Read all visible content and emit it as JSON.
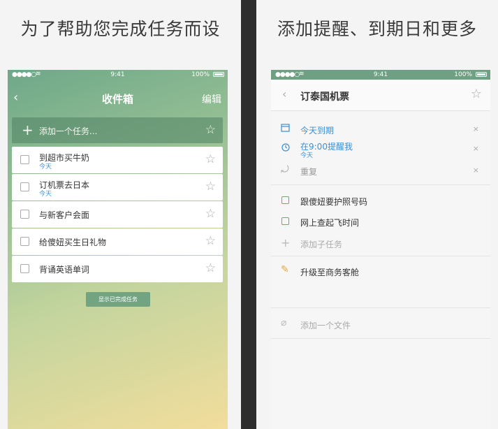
{
  "left": {
    "headline": "为了帮助您完成任务而设",
    "status": {
      "signal": "●●●●○",
      "time": "9:41",
      "battery": "100%"
    },
    "nav": {
      "back": "‹",
      "title": "收件箱",
      "edit": "编辑"
    },
    "add_task": {
      "plus": "+",
      "placeholder": "添加一个任务...",
      "star": "☆"
    },
    "tasks": [
      {
        "title": "到超市买牛奶",
        "due": "今天"
      },
      {
        "title": "订机票去日本",
        "due": "今天"
      },
      {
        "title": "与新客户会面",
        "due": ""
      },
      {
        "title": "给傻妞买生日礼物",
        "due": ""
      },
      {
        "title": "背诵英语单词",
        "due": ""
      }
    ],
    "star_glyph": "☆",
    "show_completed": "显示已完成任务"
  },
  "right": {
    "headline": "添加提醒、到期日和更多",
    "status": {
      "signal": "●●●●○",
      "time": "9:41",
      "battery": "100%"
    },
    "nav": {
      "back": "‹",
      "title": "订泰国机票",
      "star": "☆"
    },
    "details": {
      "due_date": "今天到期",
      "reminder": "在9:00提醒我",
      "reminder_sub": "今天",
      "repeat": "重复",
      "clear": "×"
    },
    "subtasks": [
      "跟傻妞要护照号码",
      "网上查起飞时间"
    ],
    "add_subtask": "添加子任务",
    "upgrade": "升级至商务客舱",
    "add_file": "添加一个文件"
  },
  "colors": {
    "accent_green": "#6fa083",
    "link_blue": "#3a8fd6"
  }
}
